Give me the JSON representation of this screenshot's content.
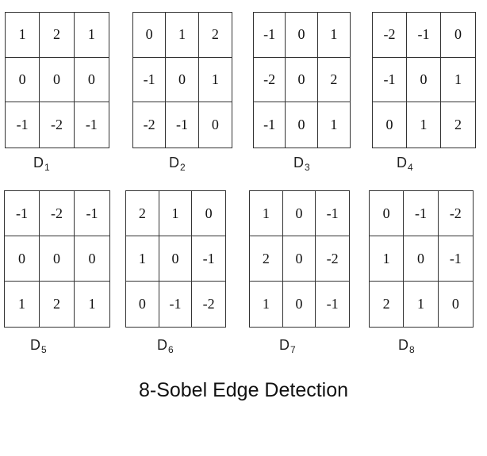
{
  "kernels": [
    {
      "name": "D",
      "sub": "1",
      "values": [
        "1",
        "2",
        "1",
        "0",
        "0",
        "0",
        "-1",
        "-2",
        "-1"
      ]
    },
    {
      "name": "D",
      "sub": "2",
      "values": [
        "0",
        "1",
        "2",
        "-1",
        "0",
        "1",
        "-2",
        "-1",
        "0"
      ]
    },
    {
      "name": "D",
      "sub": "3",
      "values": [
        "-1",
        "0",
        "1",
        "-2",
        "0",
        "2",
        "-1",
        "0",
        "1"
      ]
    },
    {
      "name": "D",
      "sub": "4",
      "values": [
        "-2",
        "-1",
        "0",
        "-1",
        "0",
        "1",
        "0",
        "1",
        "2"
      ]
    },
    {
      "name": "D",
      "sub": "5",
      "values": [
        "-1",
        "-2",
        "-1",
        "0",
        "0",
        "0",
        "1",
        "2",
        "1"
      ]
    },
    {
      "name": "D",
      "sub": "6",
      "values": [
        "2",
        "1",
        "0",
        "1",
        "0",
        "-1",
        "0",
        "-1",
        "-2"
      ]
    },
    {
      "name": "D",
      "sub": "7",
      "values": [
        "1",
        "0",
        "-1",
        "2",
        "0",
        "-2",
        "1",
        "0",
        "-1"
      ]
    },
    {
      "name": "D",
      "sub": "8",
      "values": [
        "0",
        "-1",
        "-2",
        "1",
        "0",
        "-1",
        "2",
        "1",
        "0"
      ]
    }
  ],
  "caption": "8-Sobel Edge Detection"
}
